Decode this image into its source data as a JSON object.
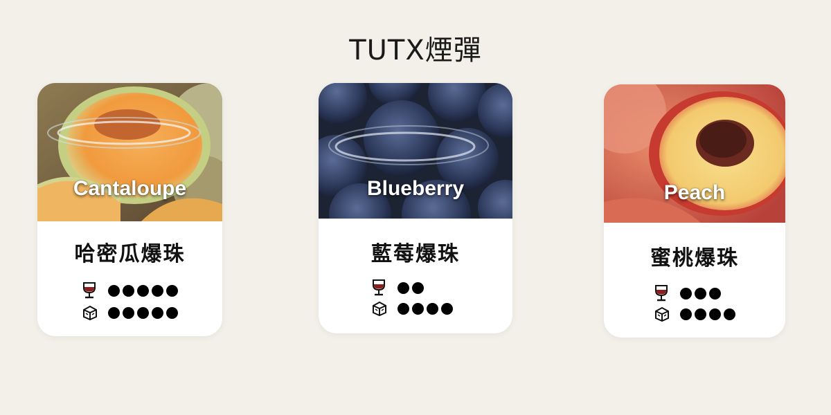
{
  "page": {
    "title": "TUTX煙彈"
  },
  "legend_icons": {
    "strength": "wine-glass-icon",
    "cooling": "ice-cube-icon"
  },
  "products": [
    {
      "en_name": "Cantaloupe",
      "cn_name": "哈密瓜爆珠",
      "strength": 5,
      "cooling": 5
    },
    {
      "en_name": "Blueberry",
      "cn_name": "藍莓爆珠",
      "strength": 2,
      "cooling": 4
    },
    {
      "en_name": "Peach",
      "cn_name": "蜜桃爆珠",
      "strength": 3,
      "cooling": 4
    }
  ]
}
